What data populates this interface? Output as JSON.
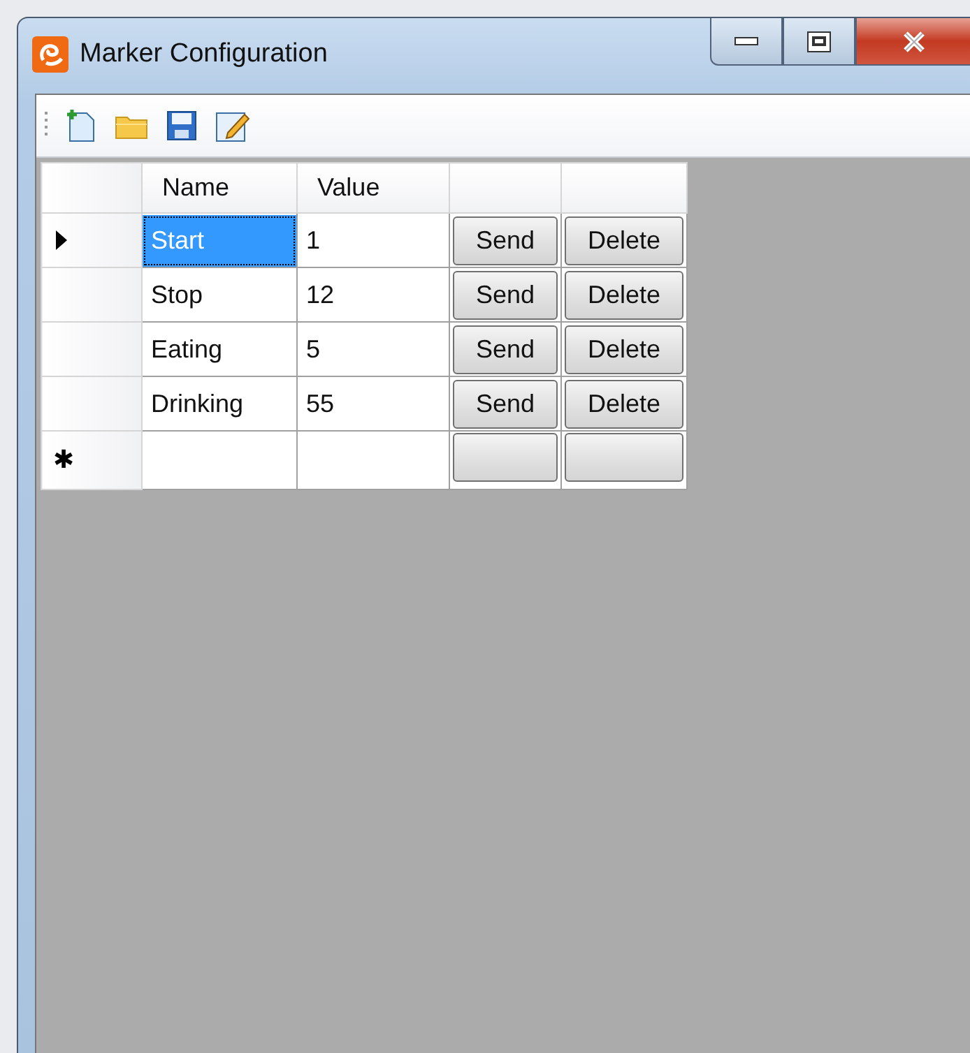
{
  "window": {
    "title": "Marker Configuration"
  },
  "grid": {
    "columns": [
      "Name",
      "Value"
    ],
    "rows": [
      {
        "name": "Start",
        "value": "1",
        "current": true,
        "selected": true,
        "buttons": [
          "Send",
          "Delete"
        ]
      },
      {
        "name": "Stop",
        "value": "12",
        "current": false,
        "selected": false,
        "buttons": [
          "Send",
          "Delete"
        ]
      },
      {
        "name": "Eating",
        "value": "5",
        "current": false,
        "selected": false,
        "buttons": [
          "Send",
          "Delete"
        ]
      },
      {
        "name": "Drinking",
        "value": "55",
        "current": false,
        "selected": false,
        "buttons": [
          "Send",
          "Delete"
        ]
      }
    ],
    "new_row": {
      "marker": "✱"
    }
  }
}
